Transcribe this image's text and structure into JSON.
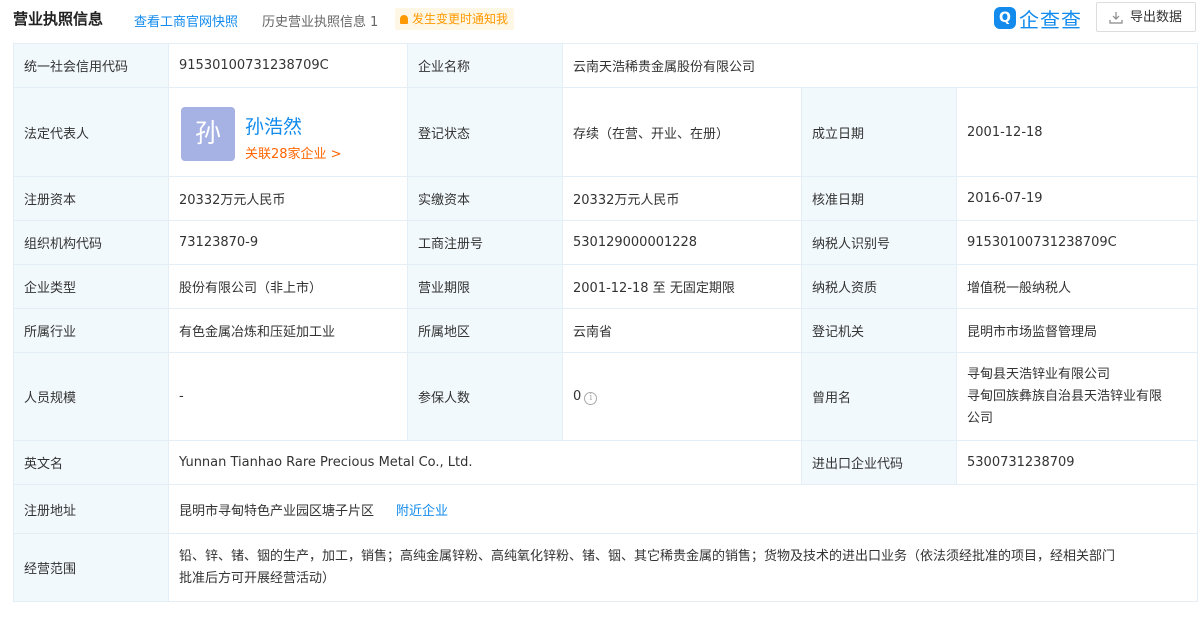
{
  "header": {
    "title": "营业执照信息",
    "gov_link": "查看工商官网快照",
    "history_label": "历史营业执照信息",
    "history_count": "1",
    "notify_label": "发生变更时通知我",
    "brand_logo": "Q",
    "brand_name": "企查查",
    "export_label": "导出数据"
  },
  "rows": {
    "credit_code": {
      "label": "统一社会信用代码",
      "value": "91530100731238709C"
    },
    "company_name": {
      "label": "企业名称",
      "value": "云南天浩稀贵金属股份有限公司"
    },
    "legal_rep": {
      "label": "法定代表人",
      "avatar": "孙",
      "name": "孙浩然",
      "related": "关联28家企业 >"
    },
    "reg_status": {
      "label": "登记状态",
      "value": "存续（在营、开业、在册）"
    },
    "found_date": {
      "label": "成立日期",
      "value": "2001-12-18"
    },
    "reg_capital": {
      "label": "注册资本",
      "value": "20332万元人民币"
    },
    "paid_capital": {
      "label": "实缴资本",
      "value": "20332万元人民币"
    },
    "approve_date": {
      "label": "核准日期",
      "value": "2016-07-19"
    },
    "org_code": {
      "label": "组织机构代码",
      "value": "73123870-9"
    },
    "biz_reg_no": {
      "label": "工商注册号",
      "value": "530129000001228"
    },
    "taxpayer_id": {
      "label": "纳税人识别号",
      "value": "91530100731238709C"
    },
    "company_type": {
      "label": "企业类型",
      "value": "股份有限公司（非上市）"
    },
    "biz_term": {
      "label": "营业期限",
      "value": "2001-12-18 至 无固定期限"
    },
    "taxpayer_qual": {
      "label": "纳税人资质",
      "value": "增值税一般纳税人"
    },
    "industry": {
      "label": "所属行业",
      "value": "有色金属冶炼和压延加工业"
    },
    "region": {
      "label": "所属地区",
      "value": "云南省"
    },
    "reg_authority": {
      "label": "登记机关",
      "value": "昆明市市场监督管理局"
    },
    "staff_size": {
      "label": "人员规模",
      "value": "-"
    },
    "insured": {
      "label": "参保人数",
      "value": "0"
    },
    "former_name": {
      "label": "曾用名",
      "value1": "寻甸县天浩锌业有限公司",
      "value2": "寻甸回族彝族自治县天浩锌业有限",
      "value3": "公司"
    },
    "english_name": {
      "label": "英文名",
      "value": "Yunnan Tianhao Rare Precious Metal Co., Ltd."
    },
    "import_export_code": {
      "label": "进出口企业代码",
      "value": "5300731238709"
    },
    "reg_address": {
      "label": "注册地址",
      "value": "昆明市寻甸特色产业园区塘子片区",
      "nearby": "附近企业"
    },
    "biz_scope": {
      "label": "经营范围",
      "value1": "铅、锌、锗、铟的生产，加工，销售；高纯金属锌粉、高纯氧化锌粉、锗、铟、其它稀贵金属的销售；货物及技术的进出口业务（依法须经批准的项目，经相关部门",
      "value2": "批准后方可开展经营活动）"
    }
  },
  "colors": {
    "accent": "#128bed",
    "label_bg": "#f2f9fc",
    "border": "#e4eef6",
    "orange": "#ff6600",
    "avatar_bg": "#a6b2e4"
  }
}
